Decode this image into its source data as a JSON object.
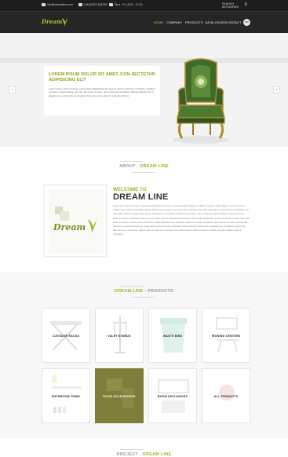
{
  "topbar": {
    "email": "info@dreamline.com",
    "phone": "(+84)0823 456789",
    "hours": "Mon - Fri: 8:00 - 17:00",
    "search_label": "SEARCH KEYWORDS"
  },
  "header": {
    "logo_text": "Dream",
    "nav": [
      "HOME",
      "COMPANY",
      "PRODUCTS",
      "CATALOGUES",
      "CONTACT"
    ],
    "active_nav": "HOME",
    "badge": "EN"
  },
  "hero": {
    "title": "LOREM IPSUM DOLOR SIT AMET, CON-SECTETUR ADIPISICING ELIT",
    "text": "Lorem ipsum dolor sit amet, consectetur adipisicing elit, sed do eiusmod tempor incididunt ut labore et dolore magna aliqua. Ut enim ad minim veniam, quis nostrud exercitation ullamco laboris nisi ut aliquip ex ea commodo consequat. Duis aute irure dolor in reprehenderit in.",
    "prev": "‹",
    "next": "›"
  },
  "about": {
    "title_prefix": "ABOUT - ",
    "title_highlight": "DREAM LINE",
    "welcome": "WELCOME TO",
    "heading": "DREAM LINE",
    "logo_text": "Dream",
    "body": "Lorem ipsum dolor sit amet, consectetur adipiscing elit, sed do eiusmod tempor incididunt ut labore et dolore magna aliqua. Ut enim ad minim veniam, quis nostrud exercitation ullamco laboris nisi ut aliquip ex ea commodo consequat. Duis aute irure dolor in reprehenderit in voluptate velit esse cillum dolore eu fugiat nulla pariatur. Excepteur sint occaecat cupidatat non proident, sunt in culpa qui officia deserunt mollit anim id est laborum. Sed ut perspiciatis unde omnis iste natus error sit voluptatem accusantium doloremque laudantium, totam rem aperiam, eaque ipsa quae ab illo inventore veritatis et quasi architecto beatae vitae dicta sunt explicabo. Nemo enim ipsam voluptatem quia voluptas sit aspernatur aut odit aut fugit, sed quia consequuntur magni dolores eos qui ratione voluptatem sequi nesciunt. Neque porro quisquam est, qui dolorem ipsum quia dolor sit amet, consectetur, adipisci velit, sed quia non numquam eius modi tempora incidunt ut labore et dolore magnam aliquam quaerat voluptatem."
  },
  "products": {
    "title_highlight": "DREAM LINE",
    "title_suffix": " - PRODUCTS",
    "items": [
      {
        "label": "LUGGAGE RACKS"
      },
      {
        "label": "VALET STANDS"
      },
      {
        "label": "WASTE BINS"
      },
      {
        "label": "IRONING CENTERS"
      },
      {
        "label": "BATHROOM ITEMS"
      },
      {
        "label": "ROOM ACCESSORIES"
      },
      {
        "label": "ROOM APPLIANCES"
      },
      {
        "label": "ALL PRODUCTS"
      }
    ]
  },
  "teaser": {
    "title_prefix": "PROJECT - ",
    "title_highlight": "DREAM LINE"
  },
  "colors": {
    "accent": "#a7b124",
    "header_bg": "#262626",
    "featured_tile": "#7f7f3b"
  }
}
